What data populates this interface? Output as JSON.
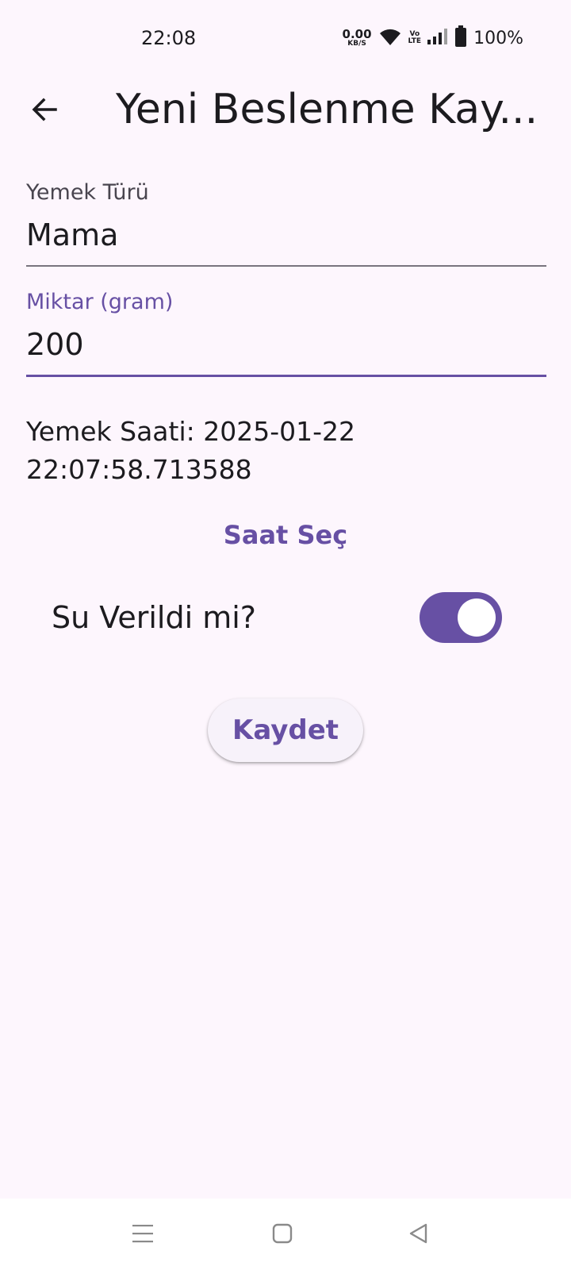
{
  "status_bar": {
    "time": "22:08",
    "net_speed_value": "0.00",
    "net_speed_unit": "KB/S",
    "volte_top": "Vo",
    "volte_bottom": "LTE",
    "battery_percent": "100%",
    "icons": [
      "wifi-icon",
      "signal-icon",
      "battery-icon"
    ]
  },
  "app_bar": {
    "title": "Yeni Beslenme Kay...",
    "back_icon": "arrow-back-icon"
  },
  "form": {
    "food_type": {
      "label": "Yemek Türü",
      "value": "Mama"
    },
    "amount": {
      "label": "Miktar (gram)",
      "value": "200"
    },
    "meal_time_line1": "Yemek Saati: 2025-01-22",
    "meal_time_line2": "22:07:58.713588",
    "pick_time_label": "Saat Seç",
    "water_label": "Su Verildi mi?",
    "water_given": true,
    "save_label": "Kaydet"
  },
  "nav_bar": {
    "icons": [
      "menu-icon",
      "home-icon",
      "back-triangle-icon"
    ]
  },
  "colors": {
    "background": "#fdf6fd",
    "accent": "#6750a4",
    "text": "#1c1b1f",
    "label": "#49454f"
  }
}
